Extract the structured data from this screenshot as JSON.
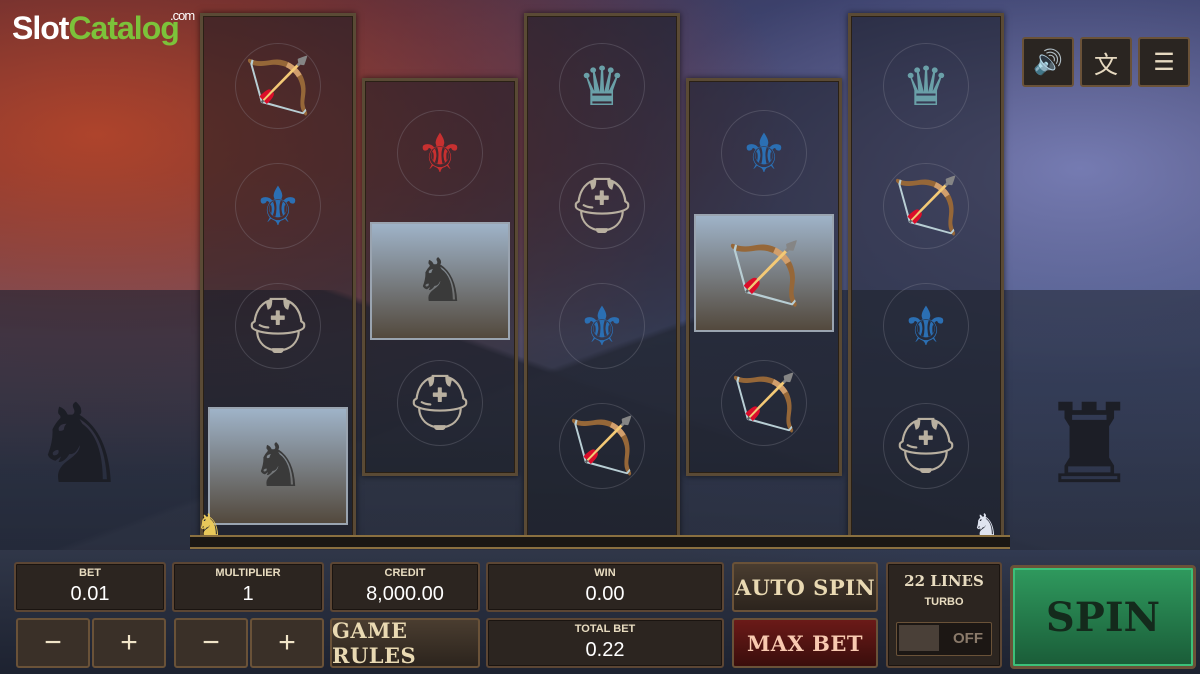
{
  "brand": {
    "word1": "Slot",
    "word2": "Catalog",
    "domain": ".com"
  },
  "top_icons": [
    {
      "name": "sound-icon",
      "glyph": "🔊"
    },
    {
      "name": "language-icon",
      "glyph": "文"
    },
    {
      "name": "menu-icon",
      "glyph": "☰"
    }
  ],
  "reels": [
    {
      "symbols": [
        "crossbow",
        "blue-flag",
        "helmet",
        "knight-card"
      ]
    },
    {
      "symbols": [
        "fleur-de-lis-shield",
        "knight-card",
        "helmet"
      ]
    },
    {
      "symbols": [
        "crown",
        "helmet",
        "blue-flag",
        "crossbow"
      ]
    },
    {
      "symbols": [
        "blue-flag",
        "archer-card",
        "crossbow"
      ]
    },
    {
      "symbols": [
        "crown",
        "crossbow",
        "blue-flag",
        "helmet"
      ]
    }
  ],
  "controls": {
    "bet_label": "BET",
    "bet_value": "0.01",
    "multiplier_label": "MULTIPLIER",
    "multiplier_value": "1",
    "credit_label": "CREDIT",
    "credit_value": "8,000.00",
    "win_label": "WIN",
    "win_value": "0.00",
    "total_bet_label": "TOTAL BET",
    "total_bet_value": "0.22",
    "minus": "−",
    "plus": "+",
    "game_rules": "GAME RULES",
    "auto_spin": "AUTO SPIN",
    "max_bet": "MAX BET",
    "lines": "22 LINES",
    "turbo_label": "TURBO",
    "turbo_state": "OFF",
    "spin": "SPIN"
  }
}
